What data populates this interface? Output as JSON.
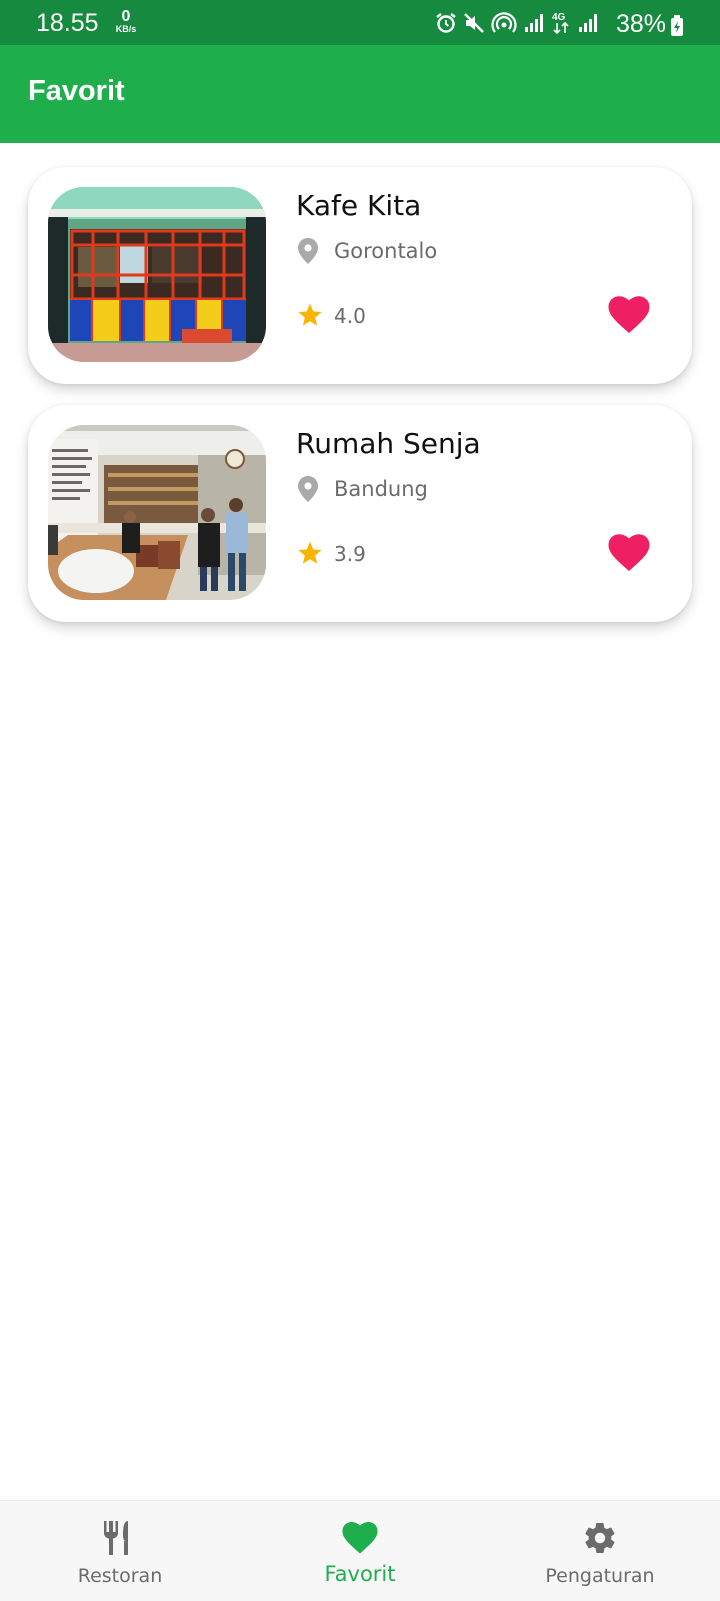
{
  "status_bar": {
    "time": "18.55",
    "net_speed_value": "0",
    "net_speed_unit": "KB/s",
    "battery": "38%",
    "icons": [
      "alarm-icon",
      "mute-icon",
      "hotspot-icon",
      "signal-icon",
      "4g-icon",
      "signal-icon",
      "battery-charging-icon"
    ]
  },
  "appbar": {
    "title": "Favorit"
  },
  "favorites": [
    {
      "name": "Kafe Kita",
      "location": "Gorontalo",
      "rating": "4.0",
      "favorited": true
    },
    {
      "name": "Rumah Senja",
      "location": "Bandung",
      "rating": "3.9",
      "favorited": true
    }
  ],
  "bottom_nav": {
    "items": [
      {
        "label": "Restoran",
        "icon": "fork-knife-icon",
        "active": false
      },
      {
        "label": "Favorit",
        "icon": "heart-icon",
        "active": true
      },
      {
        "label": "Pengaturan",
        "icon": "gear-icon",
        "active": false
      }
    ]
  },
  "colors": {
    "status_bar": "#168a3f",
    "primary": "#1fae4c",
    "heart": "#ee1f62",
    "star": "#f7b500",
    "muted": "#6b6b6b"
  }
}
